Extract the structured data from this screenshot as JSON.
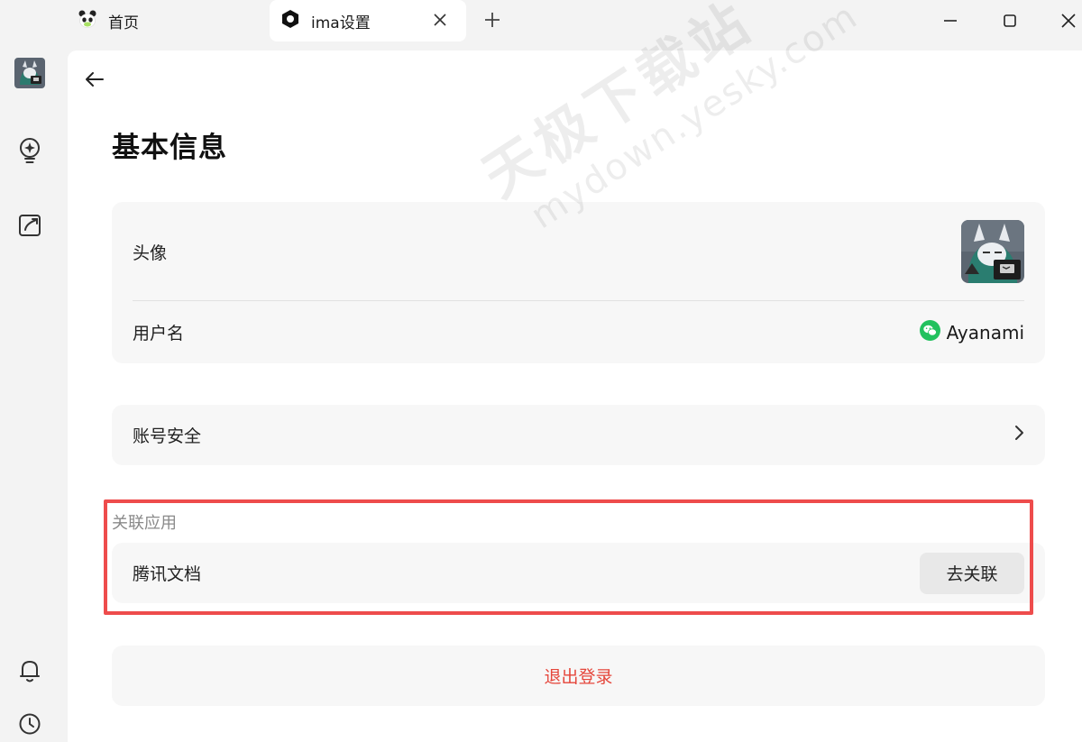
{
  "tabs": [
    {
      "label": "首页",
      "icon": "panda-icon"
    },
    {
      "label": "ima设置",
      "icon": "ima-logo-icon"
    }
  ],
  "window_controls": [
    "minimize",
    "maximize",
    "close"
  ],
  "sidebar": {
    "items": [
      {
        "icon": "user-avatar"
      },
      {
        "icon": "lightbulb-sparkle-icon"
      },
      {
        "icon": "edit-note-icon"
      },
      {
        "icon": "bell-icon"
      },
      {
        "icon": "clock-icon"
      }
    ]
  },
  "page": {
    "title": "基本信息"
  },
  "profile": {
    "avatar_label": "头像",
    "username_label": "用户名",
    "username_value": "Ayanami",
    "username_icon": "wechat-icon"
  },
  "account": {
    "security_label": "账号安全"
  },
  "linked_apps": {
    "section_label": "关联应用",
    "items": [
      {
        "name": "腾讯文档",
        "action": "去关联"
      }
    ]
  },
  "logout_label": "退出登录",
  "watermark": {
    "line1": "天极下载站",
    "line2": "mydown.yesky.com"
  },
  "colors": {
    "accent_red": "#e5463b",
    "highlight_border": "#ee4c4c",
    "wechat_green": "#22c15e"
  }
}
